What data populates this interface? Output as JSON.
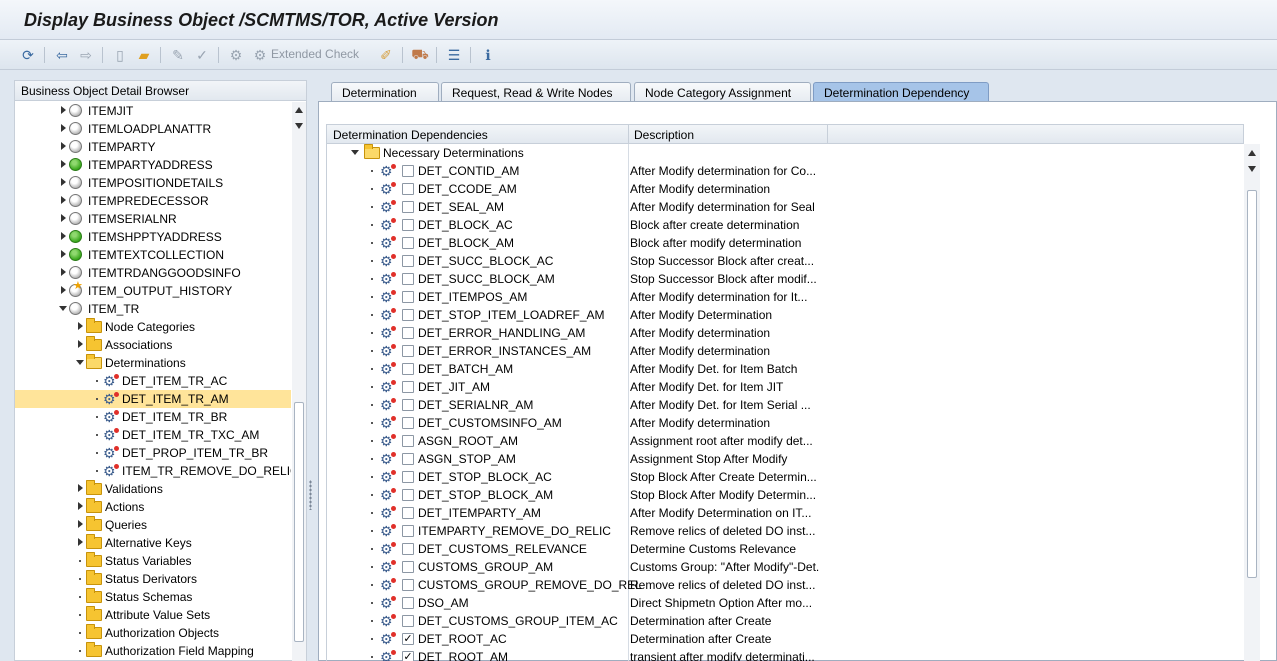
{
  "window": {
    "title": "Display Business Object /SCMTMS/TOR, Active Version"
  },
  "toolbar": {
    "items": [
      {
        "name": "other-object-icon",
        "glyph": "⟲"
      },
      {
        "name": "back-icon",
        "glyph": "⇦"
      },
      {
        "name": "forward-icon",
        "glyph": "⇨"
      },
      {
        "name": "create-icon",
        "glyph": "🗋"
      },
      {
        "name": "open-folder-icon",
        "glyph": "📂"
      },
      {
        "name": "display-change-icon",
        "glyph": "✎"
      },
      {
        "name": "check-icon",
        "glyph": "✓"
      },
      {
        "name": "activate-icon",
        "glyph": "⚙"
      },
      {
        "name": "where-used-icon",
        "glyph": "⌖"
      },
      {
        "name": "transport-icon",
        "glyph": "⛟"
      },
      {
        "name": "display-object-list-icon",
        "glyph": "☰"
      },
      {
        "name": "info-icon",
        "glyph": "ℹ"
      }
    ],
    "extended_check_label": "Extended Check"
  },
  "browser": {
    "header": "Business Object Detail Browser",
    "nodes": [
      {
        "label": "ITEMJIT",
        "icon": "gray",
        "depth": 0,
        "expander": "collapsed"
      },
      {
        "label": "ITEMLOADPLANATTR",
        "icon": "gray",
        "depth": 0,
        "expander": "collapsed"
      },
      {
        "label": "ITEMPARTY",
        "icon": "gray",
        "depth": 0,
        "expander": "collapsed"
      },
      {
        "label": "ITEMPARTYADDRESS",
        "icon": "green",
        "depth": 0,
        "expander": "collapsed"
      },
      {
        "label": "ITEMPOSITIONDETAILS",
        "icon": "gray",
        "depth": 0,
        "expander": "collapsed"
      },
      {
        "label": "ITEMPREDECESSOR",
        "icon": "gray",
        "depth": 0,
        "expander": "collapsed"
      },
      {
        "label": "ITEMSERIALNR",
        "icon": "gray",
        "depth": 0,
        "expander": "collapsed"
      },
      {
        "label": "ITEMSHPPTYADDRESS",
        "icon": "green",
        "depth": 0,
        "expander": "collapsed"
      },
      {
        "label": "ITEMTEXTCOLLECTION",
        "icon": "green",
        "depth": 0,
        "expander": "collapsed"
      },
      {
        "label": "ITEMTRDANGGOODSINFO",
        "icon": "gray",
        "depth": 0,
        "expander": "collapsed"
      },
      {
        "label": "ITEM_OUTPUT_HISTORY",
        "icon": "star",
        "depth": 0,
        "expander": "collapsed"
      },
      {
        "label": "ITEM_TR",
        "icon": "gray",
        "depth": 0,
        "expander": "expanded"
      },
      {
        "label": "Node Categories",
        "icon": "folder",
        "depth": 1,
        "expander": "collapsed"
      },
      {
        "label": "Associations",
        "icon": "folder",
        "depth": 1,
        "expander": "collapsed"
      },
      {
        "label": "Determinations",
        "icon": "folder-open",
        "depth": 1,
        "expander": "expanded"
      },
      {
        "label": "DET_ITEM_TR_AC",
        "icon": "gear",
        "depth": 2,
        "expander": "leaf"
      },
      {
        "label": "DET_ITEM_TR_AM",
        "icon": "gear",
        "depth": 2,
        "expander": "leaf",
        "selected": true
      },
      {
        "label": "DET_ITEM_TR_BR",
        "icon": "gear",
        "depth": 2,
        "expander": "leaf"
      },
      {
        "label": "DET_ITEM_TR_TXC_AM",
        "icon": "gear",
        "depth": 2,
        "expander": "leaf"
      },
      {
        "label": "DET_PROP_ITEM_TR_BR",
        "icon": "gear",
        "depth": 2,
        "expander": "leaf"
      },
      {
        "label": "ITEM_TR_REMOVE_DO_RELIC",
        "icon": "gear",
        "depth": 2,
        "expander": "leaf"
      },
      {
        "label": "Validations",
        "icon": "folder",
        "depth": 1,
        "expander": "collapsed"
      },
      {
        "label": "Actions",
        "icon": "folder",
        "depth": 1,
        "expander": "collapsed"
      },
      {
        "label": "Queries",
        "icon": "folder",
        "depth": 1,
        "expander": "collapsed"
      },
      {
        "label": "Alternative Keys",
        "icon": "folder",
        "depth": 1,
        "expander": "collapsed"
      },
      {
        "label": "Status Variables",
        "icon": "folder",
        "depth": 1,
        "expander": "leaf"
      },
      {
        "label": "Status Derivators",
        "icon": "folder",
        "depth": 1,
        "expander": "leaf"
      },
      {
        "label": "Status Schemas",
        "icon": "folder",
        "depth": 1,
        "expander": "leaf"
      },
      {
        "label": "Attribute Value Sets",
        "icon": "folder",
        "depth": 1,
        "expander": "leaf"
      },
      {
        "label": "Authorization Objects",
        "icon": "folder",
        "depth": 1,
        "expander": "leaf"
      },
      {
        "label": "Authorization Field Mapping",
        "icon": "folder",
        "depth": 1,
        "expander": "leaf"
      }
    ]
  },
  "tabs": [
    {
      "label": "Determination",
      "active": false
    },
    {
      "label": "Request, Read & Write Nodes",
      "active": false
    },
    {
      "label": "Node Category Assignment",
      "active": false
    },
    {
      "label": "Determination Dependency",
      "active": true
    }
  ],
  "table": {
    "columns": [
      "Determination Dependencies",
      "Description"
    ],
    "group_label": "Necessary Determinations",
    "rows": [
      {
        "name": "DET_CONTID_AM",
        "desc": "After Modify determination for Co...",
        "checked": false
      },
      {
        "name": "DET_CCODE_AM",
        "desc": "After Modify determination",
        "checked": false
      },
      {
        "name": "DET_SEAL_AM",
        "desc": "After Modify determination for Seal",
        "checked": false
      },
      {
        "name": "DET_BLOCK_AC",
        "desc": "Block after create determination",
        "checked": false
      },
      {
        "name": "DET_BLOCK_AM",
        "desc": "Block after modify determination",
        "checked": false
      },
      {
        "name": "DET_SUCC_BLOCK_AC",
        "desc": "Stop Successor Block after creat...",
        "checked": false
      },
      {
        "name": "DET_SUCC_BLOCK_AM",
        "desc": "Stop Successor Block after modif...",
        "checked": false
      },
      {
        "name": "DET_ITEMPOS_AM",
        "desc": "After Modify determination for It...",
        "checked": false
      },
      {
        "name": "DET_STOP_ITEM_LOADREF_AM",
        "desc": "After Modify Determination",
        "checked": false
      },
      {
        "name": "DET_ERROR_HANDLING_AM",
        "desc": "After Modify determination",
        "checked": false
      },
      {
        "name": "DET_ERROR_INSTANCES_AM",
        "desc": "After Modify determination",
        "checked": false
      },
      {
        "name": "DET_BATCH_AM",
        "desc": "After Modify Det. for Item Batch",
        "checked": false
      },
      {
        "name": "DET_JIT_AM",
        "desc": "After Modify Det. for Item JIT",
        "checked": false
      },
      {
        "name": "DET_SERIALNR_AM",
        "desc": "After Modify Det. for Item Serial ...",
        "checked": false
      },
      {
        "name": "DET_CUSTOMSINFO_AM",
        "desc": "After Modify determination",
        "checked": false
      },
      {
        "name": "ASGN_ROOT_AM",
        "desc": "Assignment root after modify det...",
        "checked": false
      },
      {
        "name": "ASGN_STOP_AM",
        "desc": "Assignment Stop After Modify",
        "checked": false
      },
      {
        "name": "DET_STOP_BLOCK_AC",
        "desc": "Stop Block After Create Determin...",
        "checked": false
      },
      {
        "name": "DET_STOP_BLOCK_AM",
        "desc": "Stop Block After Modify Determin...",
        "checked": false
      },
      {
        "name": "DET_ITEMPARTY_AM",
        "desc": "After Modify Determination on IT...",
        "checked": false
      },
      {
        "name": "ITEMPARTY_REMOVE_DO_RELIC",
        "desc": "Remove relics of deleted DO inst...",
        "checked": false
      },
      {
        "name": "DET_CUSTOMS_RELEVANCE",
        "desc": " Determine Customs Relevance",
        "checked": false
      },
      {
        "name": "CUSTOMS_GROUP_AM",
        "desc": "Customs Group: \"After Modify\"-Det.",
        "checked": false
      },
      {
        "name": "CUSTOMS_GROUP_REMOVE_DO_REL",
        "desc": "Remove relics of deleted DO inst...",
        "checked": false
      },
      {
        "name": "DSO_AM",
        "desc": "Direct Shipmetn Option After mo...",
        "checked": false
      },
      {
        "name": "DET_CUSTOMS_GROUP_ITEM_AC",
        "desc": "Determination after Create",
        "checked": false
      },
      {
        "name": "DET_ROOT_AC",
        "desc": "Determination after Create",
        "checked": true
      },
      {
        "name": "DET_ROOT_AM",
        "desc": "transient after modify determinati...",
        "checked": true
      }
    ]
  },
  "colors": {
    "selected_row": "#ffe49a",
    "active_tab": "#a6c4e8",
    "background": "#dfe7f0"
  }
}
